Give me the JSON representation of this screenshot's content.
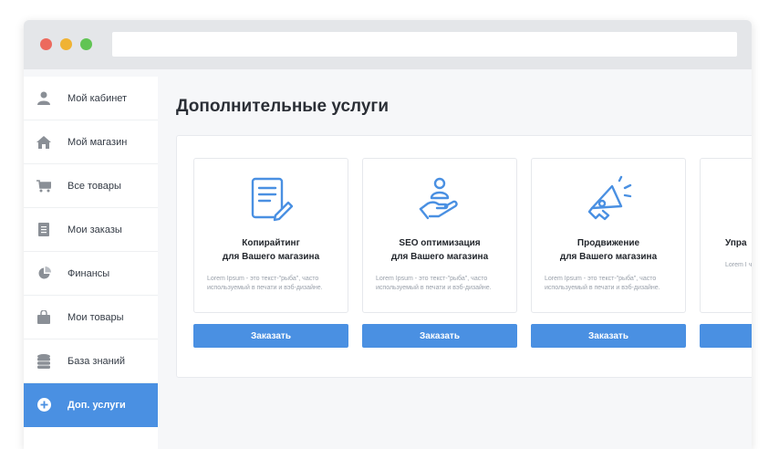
{
  "sidebar": {
    "items": [
      {
        "label": "Мой кабинет",
        "icon": "user-icon"
      },
      {
        "label": "Мой магазин",
        "icon": "home-icon"
      },
      {
        "label": "Все товары",
        "icon": "cart-icon"
      },
      {
        "label": "Мои заказы",
        "icon": "document-icon"
      },
      {
        "label": "Финансы",
        "icon": "pie-chart-icon"
      },
      {
        "label": "Мои товары",
        "icon": "shopping-bag-icon"
      },
      {
        "label": "База знаний",
        "icon": "database-icon"
      },
      {
        "label": "Доп. услуги",
        "icon": "plus-circle-icon",
        "active": true
      }
    ]
  },
  "main": {
    "title": "Дополнительные услуги",
    "cards": [
      {
        "title_line1": "Копирайтинг",
        "title_line2": "для Вашего магазина",
        "desc": "Lorem Ipsum - это текст-\"рыба\", часто используемый в печати и вэб-дизайне.",
        "button": "Заказать",
        "icon": "document-edit-icon"
      },
      {
        "title_line1": "SEO оптимизация",
        "title_line2": "для Вашего магазина",
        "desc": "Lorem Ipsum - это текст-\"рыба\", часто используемый в печати и вэб-дизайне.",
        "button": "Заказать",
        "icon": "hand-user-icon"
      },
      {
        "title_line1": "Продвижение",
        "title_line2": "для Вашего магазина",
        "desc": "Lorem Ipsum - это текст-\"рыба\", часто используемый в печати и вэб-дизайне.",
        "button": "Заказать",
        "icon": "megaphone-icon"
      },
      {
        "title_line1": "Упра",
        "title_line2": "",
        "desc": "Lorem I часто и вэб-диз",
        "button": "",
        "icon": ""
      }
    ]
  },
  "colors": {
    "accent": "#4a90e2",
    "icon_gray": "#8a8f96"
  }
}
